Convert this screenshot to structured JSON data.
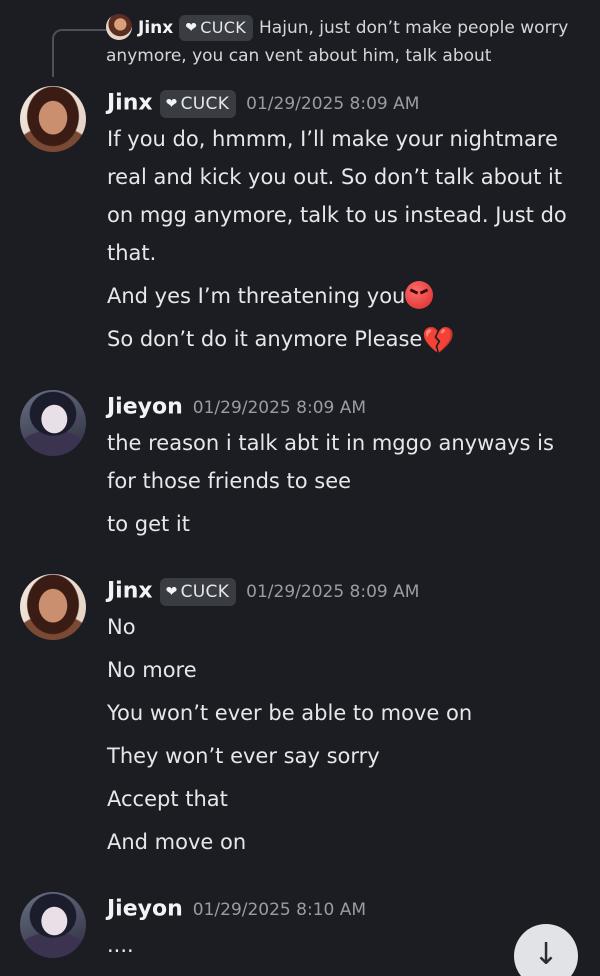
{
  "reply": {
    "author": "Jinx",
    "tag": "CUCK",
    "text": "Hajun, just don’t make people worry anymore, you can vent about him, talk about"
  },
  "messages": [
    {
      "author": "Jinx",
      "tag": "CUCK",
      "time": "01/29/2025 8:09 AM",
      "lines": [
        "If you do, hmmm, I’ll make your nightmare real and kick you out. So don’t talk about it on mgg anymore, talk to us instead. Just do that.",
        "And yes I’m threatening you",
        "So don’t do it anymore Please"
      ]
    },
    {
      "author": "Jieyon",
      "time": "01/29/2025 8:09 AM",
      "lines": [
        "the reason i talk abt it in mggo anyways is for those friends to see",
        "to get it"
      ]
    },
    {
      "author": "Jinx",
      "tag": "CUCK",
      "time": "01/29/2025 8:09 AM",
      "lines": [
        "No",
        "No more",
        "You won’t ever be able to move on",
        "They won’t ever say sorry",
        "Accept that",
        "And move on"
      ]
    },
    {
      "author": "Jieyon",
      "time": "01/29/2025 8:10 AM",
      "lines": [
        "...."
      ]
    }
  ],
  "icons": {
    "tag_heart": "heart-icon",
    "angry_emoji": "angry-face-emoji",
    "broken_heart_emoji": "broken-heart-emoji",
    "scroll_down": "arrow-down-icon"
  },
  "colors": {
    "background": "#1c1d22",
    "text": "#e6e7ea",
    "timestamp": "#9a9ca4",
    "tag_bg": "#3a3c43",
    "scroll_button": "#e2e3e6"
  }
}
